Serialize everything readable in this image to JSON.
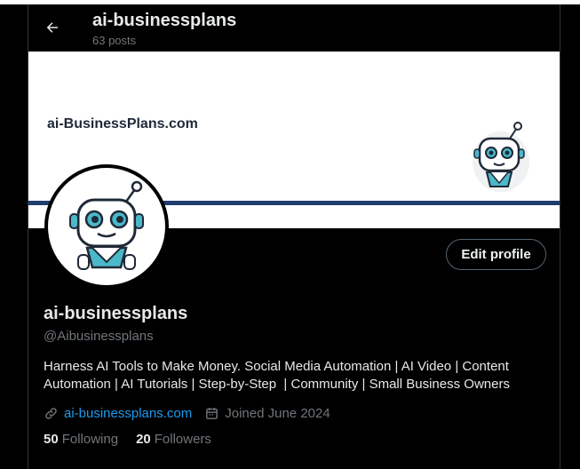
{
  "header": {
    "title": "ai-businessplans",
    "posts": "63 posts",
    "back_icon": "arrow-left-icon"
  },
  "banner": {
    "text": "ai-BusinessPlans.com",
    "line_color": "#213d6e",
    "robot_icon": "robot-mascot-icon"
  },
  "avatar": {
    "icon": "robot-mascot-icon"
  },
  "actions": {
    "edit_profile": "Edit profile"
  },
  "profile": {
    "display_name": "ai-businessplans",
    "handle": "@Aibusinessplans",
    "bio_lines": [
      "Harness AI Tools to Make Money. Social Media Automation | AI Video | Content",
      "Automation | AI Tutorials | Step-by-Step  | Community | Small Business Owners"
    ],
    "website": "ai-businessplans.com",
    "joined": "Joined June 2024"
  },
  "stats": {
    "following_count": "50",
    "following_label": "Following",
    "followers_count": "20",
    "followers_label": "Followers"
  },
  "colors": {
    "background": "#000000",
    "text_primary": "#e7e9ea",
    "text_secondary": "#71767b",
    "link": "#1d9bf0",
    "border": "#2f3336",
    "robot_accent": "#4ab8c9"
  }
}
